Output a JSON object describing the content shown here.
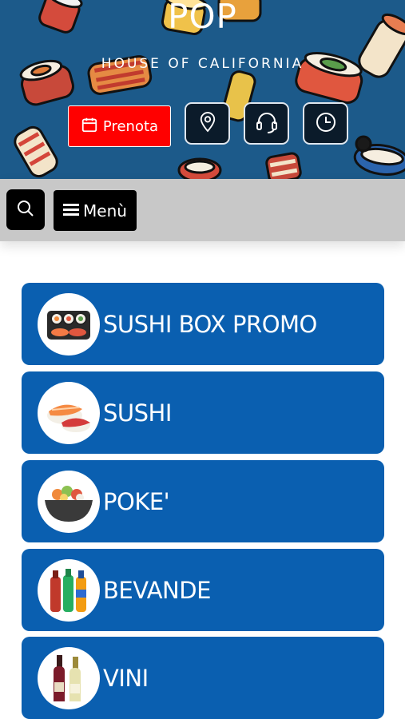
{
  "header": {
    "title": "POP",
    "subtitle": "HOUSE OF CALIFORNIA",
    "book_button_label": "Prenota",
    "action_icons": [
      "location-pin-icon",
      "headset-icon",
      "clock-icon"
    ],
    "background_color": "#1c5a8a"
  },
  "toolbar": {
    "menu_label": "Menù"
  },
  "categories": [
    {
      "label": "SUSHI BOX PROMO",
      "icon": "sushi-box-icon"
    },
    {
      "label": "SUSHI",
      "icon": "nigiri-icon"
    },
    {
      "label": "POKE'",
      "icon": "poke-bowl-icon"
    },
    {
      "label": "BEVANDE",
      "icon": "drinks-icon"
    },
    {
      "label": "VINI",
      "icon": "wine-bottles-icon"
    }
  ],
  "colors": {
    "book_button": "#ff0000",
    "category_card": "#0a5fb0",
    "toolbar": "#c8c8c8"
  }
}
